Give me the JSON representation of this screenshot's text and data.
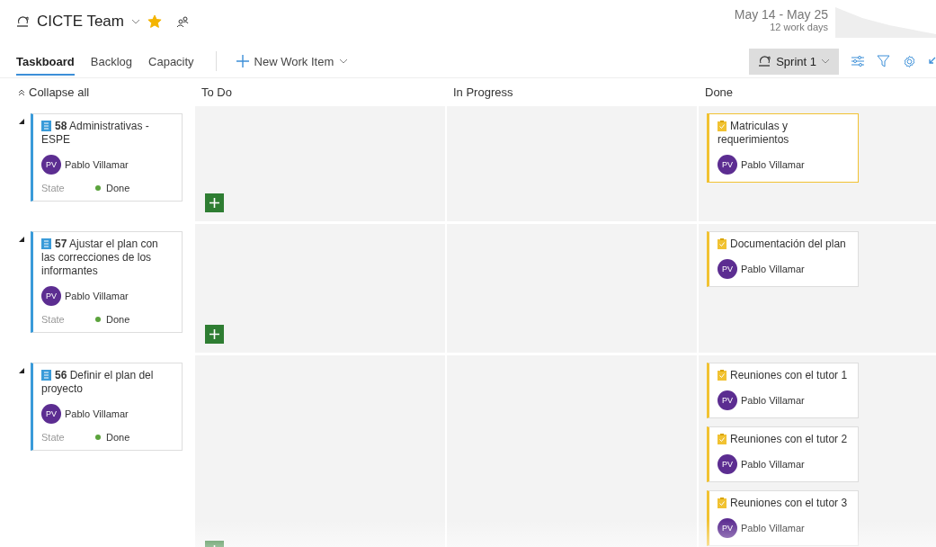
{
  "header": {
    "team": "CICTE Team",
    "favorite": true,
    "dates": "May 14 - May 25",
    "work_days": "12 work days"
  },
  "tabs": [
    {
      "label": "Taskboard",
      "selected": true
    },
    {
      "label": "Backlog",
      "selected": false
    },
    {
      "label": "Capacity",
      "selected": false
    }
  ],
  "new_item": "New Work Item",
  "sprint": "Sprint 1",
  "collapse": "Collapse all",
  "columns": [
    "To Do",
    "In Progress",
    "Done"
  ],
  "rows": [
    {
      "expanded": true,
      "id": "58",
      "title": "Administrativas - ESPE",
      "initials": "PV",
      "assignee": "Pablo Villamar",
      "state_label": "State",
      "state": "Done",
      "color": "#5ba33c",
      "done_tasks": [
        {
          "title": "Matriculas y requerimientos",
          "initials": "PV",
          "assignee": "Pablo Villamar",
          "selected": true
        }
      ]
    },
    {
      "expanded": true,
      "id": "57",
      "title": "Ajustar el plan con las correcciones de los informantes",
      "initials": "PV",
      "assignee": "Pablo Villamar",
      "state_label": "State",
      "state": "Done",
      "color": "#5ba33c",
      "done_tasks": [
        {
          "title": "Documentación del plan",
          "initials": "PV",
          "assignee": "Pablo Villamar",
          "selected": false
        }
      ]
    },
    {
      "expanded": true,
      "id": "56",
      "title": "Definir el plan del proyecto",
      "initials": "PV",
      "assignee": "Pablo Villamar",
      "state_label": "State",
      "state": "Done",
      "color": "#5ba33c",
      "done_tasks": [
        {
          "title": "Reuniones con el tutor 1",
          "initials": "PV",
          "assignee": "Pablo Villamar",
          "selected": false
        },
        {
          "title": "Reuniones con el tutor 2",
          "initials": "PV",
          "assignee": "Pablo Villamar",
          "selected": false
        },
        {
          "title": "Reuniones con el tutor 3",
          "initials": "PV",
          "assignee": "Pablo Villamar",
          "selected": false
        }
      ]
    }
  ]
}
